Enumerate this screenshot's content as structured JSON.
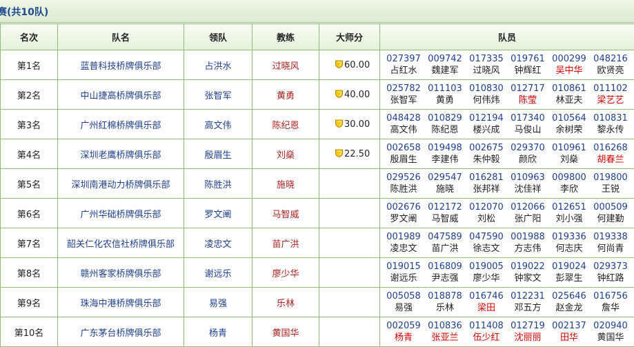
{
  "title": "赛(共10队)",
  "headers": {
    "rank": "名次",
    "team": "队名",
    "leader": "领队",
    "coach": "教练",
    "master": "大师分",
    "members": "队员"
  },
  "rows": [
    {
      "rank": "第1名",
      "team": "蓝普科技桥牌俱乐部",
      "leader": "占洪水",
      "coach": "过晓风",
      "master": "60.00",
      "members": [
        {
          "id": "027397",
          "name": "占红水",
          "red": false
        },
        {
          "id": "009742",
          "name": "魏建军",
          "red": false
        },
        {
          "id": "017335",
          "name": "过晓风",
          "red": false
        },
        {
          "id": "019761",
          "name": "钟辉红",
          "red": false
        },
        {
          "id": "000299",
          "name": "吴中华",
          "red": true
        },
        {
          "id": "048216",
          "name": "欧贤亮",
          "red": false
        }
      ]
    },
    {
      "rank": "第2名",
      "team": "中山捷高桥牌俱乐部",
      "leader": "张智军",
      "coach": "黄勇",
      "master": "40.00",
      "members": [
        {
          "id": "025782",
          "name": "张智军",
          "red": false
        },
        {
          "id": "011103",
          "name": "黄勇",
          "red": false
        },
        {
          "id": "010830",
          "name": "何伟炜",
          "red": false
        },
        {
          "id": "012717",
          "name": "陈莹",
          "red": true
        },
        {
          "id": "010861",
          "name": "林亚夫",
          "red": false
        },
        {
          "id": "011102",
          "name": "梁艺艺",
          "red": true
        }
      ]
    },
    {
      "rank": "第3名",
      "team": "广州红棉桥牌俱乐部",
      "leader": "高文伟",
      "coach": "陈纪恩",
      "master": "30.00",
      "members": [
        {
          "id": "048428",
          "name": "高文伟",
          "red": false
        },
        {
          "id": "010829",
          "name": "陈纪恩",
          "red": false
        },
        {
          "id": "012194",
          "name": "楼兴成",
          "red": false
        },
        {
          "id": "017340",
          "name": "马俊山",
          "red": false
        },
        {
          "id": "010564",
          "name": "余树荣",
          "red": false
        },
        {
          "id": "010831",
          "name": "黎永传",
          "red": false
        }
      ]
    },
    {
      "rank": "第4名",
      "team": "深圳老鹰桥牌俱乐部",
      "leader": "殷眉生",
      "coach": "刘燊",
      "master": "22.50",
      "members": [
        {
          "id": "002658",
          "name": "殷眉生",
          "red": false
        },
        {
          "id": "019498",
          "name": "李建伟",
          "red": false
        },
        {
          "id": "002675",
          "name": "朱仲毅",
          "red": false
        },
        {
          "id": "029370",
          "name": "颜欣",
          "red": false
        },
        {
          "id": "010961",
          "name": "刘燊",
          "red": false
        },
        {
          "id": "016268",
          "name": "胡春兰",
          "red": true
        }
      ]
    },
    {
      "rank": "第5名",
      "team": "深圳南港动力桥牌俱乐部",
      "leader": "陈胜洪",
      "coach": "施晓",
      "master": "",
      "members": [
        {
          "id": "029526",
          "name": "陈胜洪",
          "red": false
        },
        {
          "id": "029547",
          "name": "施晓",
          "red": false
        },
        {
          "id": "016281",
          "name": "张邦祥",
          "red": false
        },
        {
          "id": "010963",
          "name": "沈佳祥",
          "red": false
        },
        {
          "id": "009800",
          "name": "李欣",
          "red": false
        },
        {
          "id": "019800",
          "name": "王锐",
          "red": false
        }
      ]
    },
    {
      "rank": "第6名",
      "team": "广州华础桥牌俱乐部",
      "leader": "罗文阐",
      "coach": "马智威",
      "master": "",
      "members": [
        {
          "id": "002676",
          "name": "罗文阐",
          "red": false
        },
        {
          "id": "012172",
          "name": "马智威",
          "red": false
        },
        {
          "id": "012070",
          "name": "刘松",
          "red": false
        },
        {
          "id": "012066",
          "name": "张广阳",
          "red": false
        },
        {
          "id": "012651",
          "name": "刘小强",
          "red": false
        },
        {
          "id": "000509",
          "name": "何建勤",
          "red": false
        }
      ]
    },
    {
      "rank": "第7名",
      "team": "韶关仁化农信社桥牌俱乐部",
      "leader": "凌忠文",
      "coach": "苗广洪",
      "master": "",
      "members": [
        {
          "id": "001989",
          "name": "凌忠文",
          "red": false
        },
        {
          "id": "047589",
          "name": "苗广洪",
          "red": false
        },
        {
          "id": "047590",
          "name": "徐志文",
          "red": false
        },
        {
          "id": "001988",
          "name": "方志伟",
          "red": false
        },
        {
          "id": "019336",
          "name": "何志庆",
          "red": false
        },
        {
          "id": "019338",
          "name": "何尚青",
          "red": false
        }
      ]
    },
    {
      "rank": "第8名",
      "team": "赣州客家桥牌俱乐部",
      "leader": "谢远乐",
      "coach": "廖少华",
      "master": "",
      "members": [
        {
          "id": "019015",
          "name": "谢远乐",
          "red": false
        },
        {
          "id": "016809",
          "name": "尹志强",
          "red": false
        },
        {
          "id": "019005",
          "name": "廖少华",
          "red": false
        },
        {
          "id": "019022",
          "name": "钟家文",
          "red": false
        },
        {
          "id": "019024",
          "name": "彭翠生",
          "red": false
        },
        {
          "id": "029373",
          "name": "钟红路",
          "red": false
        }
      ]
    },
    {
      "rank": "第9名",
      "team": "珠海中港桥牌俱乐部",
      "leader": "易强",
      "coach": "乐林",
      "master": "",
      "members": [
        {
          "id": "005058",
          "name": "易强",
          "red": false
        },
        {
          "id": "018878",
          "name": "乐林",
          "red": false
        },
        {
          "id": "016746",
          "name": "梁田",
          "red": true
        },
        {
          "id": "012231",
          "name": "邓五方",
          "red": false
        },
        {
          "id": "025646",
          "name": "赵金龙",
          "red": false
        },
        {
          "id": "016756",
          "name": "詹华",
          "red": false
        }
      ]
    },
    {
      "rank": "第10名",
      "team": "广东茅台桥牌俱乐部",
      "leader": "杨青",
      "coach": "黄国华",
      "master": "",
      "members": [
        {
          "id": "002059",
          "name": "杨青",
          "red": true
        },
        {
          "id": "010836",
          "name": "张亚兰",
          "red": true
        },
        {
          "id": "011408",
          "name": "伍少红",
          "red": true
        },
        {
          "id": "012719",
          "name": "沈丽丽",
          "red": true
        },
        {
          "id": "002137",
          "name": "田华",
          "red": true
        },
        {
          "id": "020940",
          "name": "黄国华",
          "red": false
        }
      ]
    }
  ]
}
